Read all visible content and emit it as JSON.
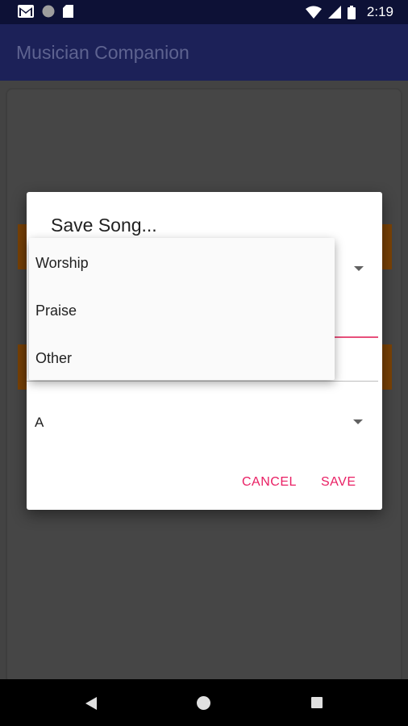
{
  "status_bar": {
    "icons_left": [
      "gmail-icon",
      "circle-notification-icon",
      "sd-card-icon"
    ],
    "icons_right": [
      "wifi-icon",
      "cell-signal-icon",
      "battery-icon"
    ],
    "time": "2:19"
  },
  "app_bar": {
    "title": "Musician Companion"
  },
  "dialog": {
    "title": "Save Song...",
    "key_value": "A",
    "cancel_label": "CANCEL",
    "save_label": "SAVE"
  },
  "dropdown": {
    "options": [
      "Worship",
      "Praise",
      "Other"
    ]
  },
  "colors": {
    "status_bar": "#0d1136",
    "app_bar": "#1c2158",
    "accent": "#e91e63",
    "orange_strip": "#7a4206"
  }
}
